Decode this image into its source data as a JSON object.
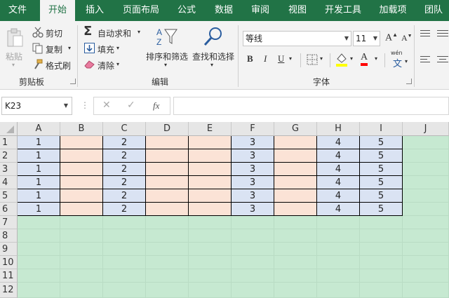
{
  "tabs": [
    "文件",
    "开始",
    "插入",
    "页面布局",
    "公式",
    "数据",
    "审阅",
    "视图",
    "开发工具",
    "加载项",
    "团队"
  ],
  "active_tab": "开始",
  "clipboard": {
    "paste": "粘贴",
    "cut": "剪切",
    "copy": "复制",
    "format_painter": "格式刷",
    "group": "剪贴板"
  },
  "editing": {
    "autosum": "自动求和",
    "fill": "填充",
    "clear": "清除",
    "sort_filter": "排序和筛选",
    "find_select": "查找和选择",
    "group": "编辑"
  },
  "font": {
    "name": "等线",
    "size": "11",
    "grow": "A",
    "shrink": "A",
    "bold": "B",
    "italic": "I",
    "underline": "U",
    "font_color": "A",
    "phonetic": "wén",
    "group": "字体"
  },
  "formula_bar": {
    "name_box": "K23",
    "cancel": "✕",
    "enter": "✓",
    "fx": "fx",
    "value": ""
  },
  "sheet": {
    "columns": [
      "A",
      "B",
      "C",
      "D",
      "E",
      "F",
      "G",
      "H",
      "I",
      "J"
    ],
    "rows": [
      "1",
      "2",
      "3",
      "4",
      "5",
      "6",
      "7",
      "8",
      "9",
      "10",
      "11",
      "12"
    ],
    "cells": [
      [
        "1",
        "",
        "2",
        "",
        "",
        "3",
        "",
        "4",
        "5"
      ],
      [
        "1",
        "",
        "2",
        "",
        "",
        "3",
        "",
        "4",
        "5"
      ],
      [
        "1",
        "",
        "2",
        "",
        "",
        "3",
        "",
        "4",
        "5"
      ],
      [
        "1",
        "",
        "2",
        "",
        "",
        "3",
        "",
        "4",
        "5"
      ],
      [
        "1",
        "",
        "2",
        "",
        "",
        "3",
        "",
        "4",
        "5"
      ],
      [
        "1",
        "",
        "2",
        "",
        "",
        "3",
        "",
        "4",
        "5"
      ]
    ],
    "colors": {
      "blue": "#dae3f3",
      "peach": "#fbe3d6",
      "green": "#c6e9d1",
      "accent": "#217346"
    }
  }
}
